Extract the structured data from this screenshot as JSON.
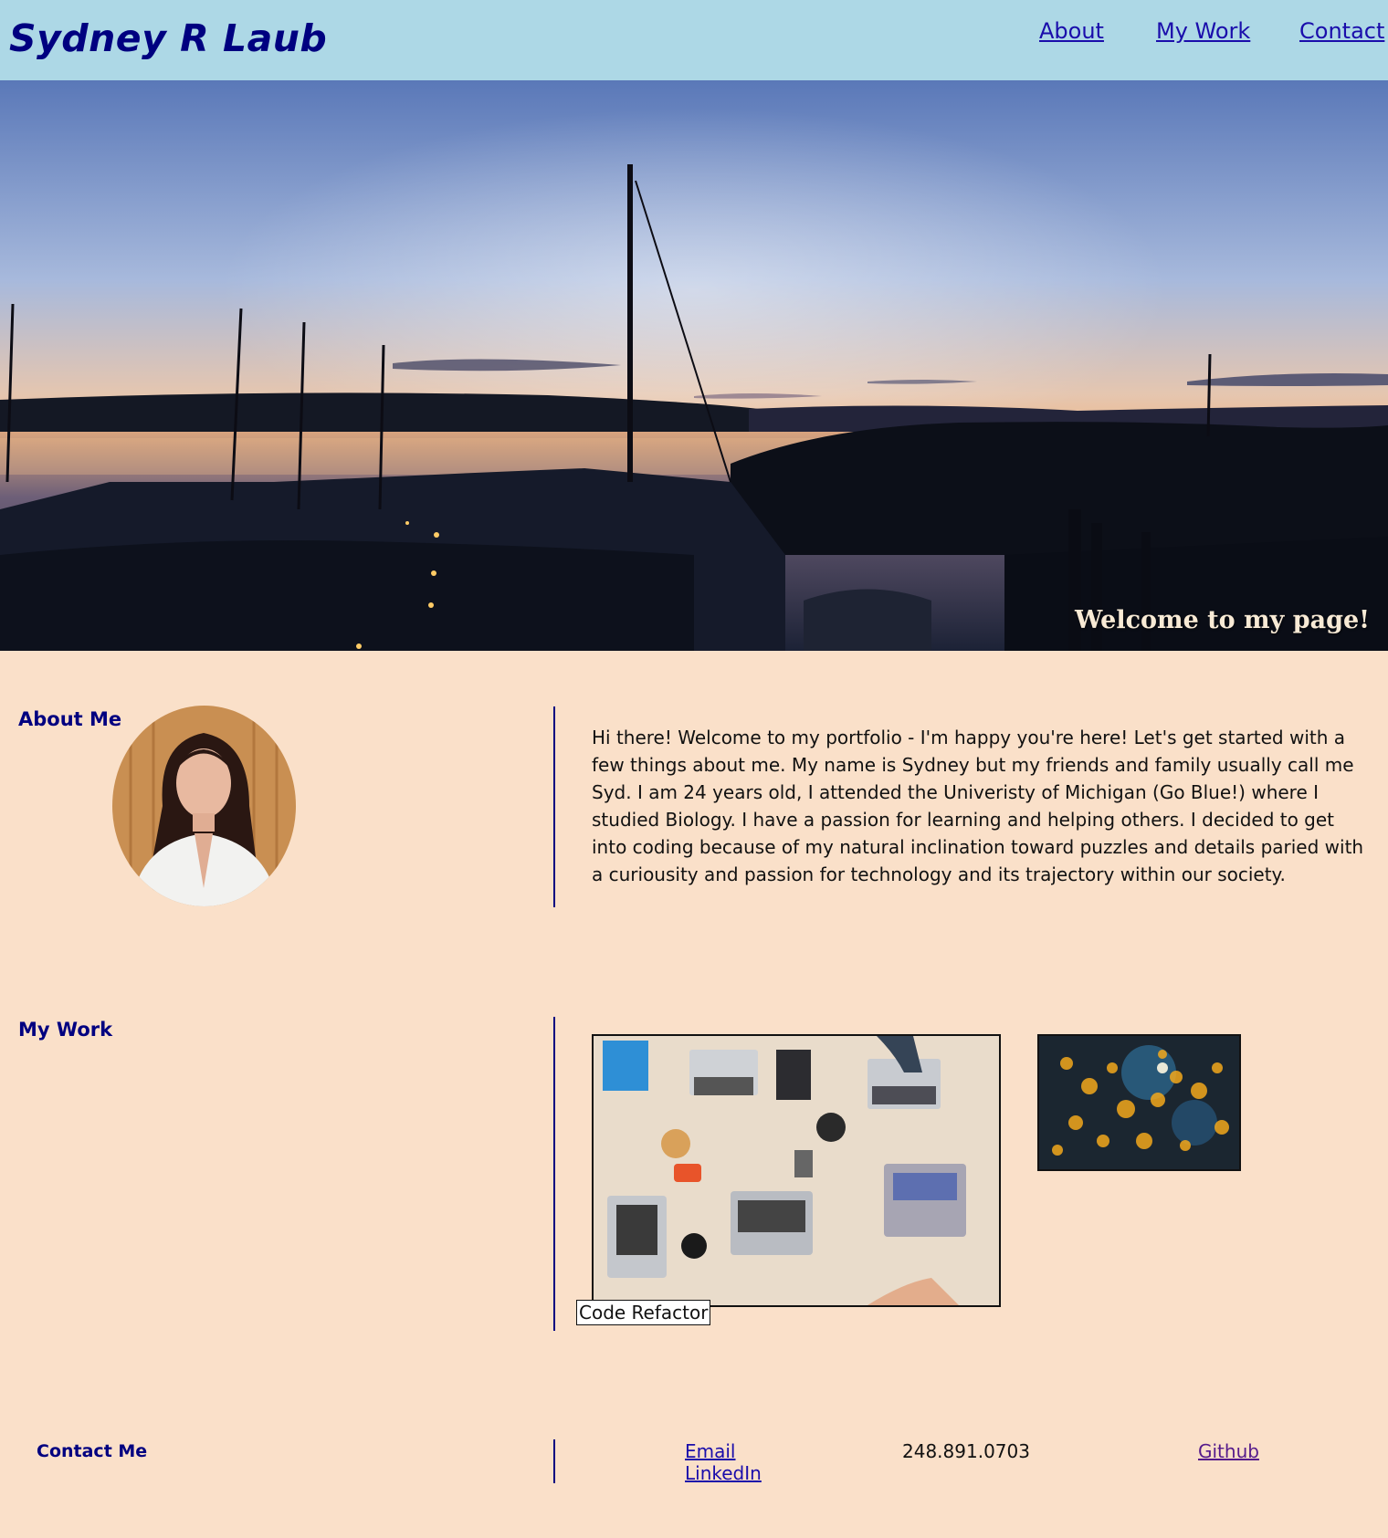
{
  "header": {
    "title": "Sydney R Laub",
    "nav": [
      {
        "label": "About"
      },
      {
        "label": "My Work"
      },
      {
        "label": "Contact"
      }
    ]
  },
  "hero": {
    "welcome_text": "Welcome to my page!"
  },
  "about": {
    "heading": "About Me",
    "paragraph": "Hi there! Welcome to my portfolio - I'm happy you're here! Let's get started with a few things about me. My name is Sydney but my friends and family usually call me Syd. I am 24 years old, I attended the Univeristy of Michigan (Go Blue!) where I studied Biology. I have a passion for learning and helping others. I decided to get into coding because of my natural inclination toward puzzles and details paried with a curiousity and passion for technology and its trajectory within our society."
  },
  "work": {
    "heading": "My Work",
    "projects": [
      {
        "label": "Code Refactor"
      }
    ]
  },
  "contact": {
    "heading": "Contact Me",
    "email_label": "Email",
    "linkedin_label": "LinkedIn",
    "phone": "248.891.0703",
    "github_label": "Github"
  },
  "colors": {
    "header_bg": "#add8e6",
    "page_bg": "#fae0c9",
    "heading_navy": "#000080",
    "link_blue": "#1a0dab",
    "link_visited": "#551a8b"
  }
}
